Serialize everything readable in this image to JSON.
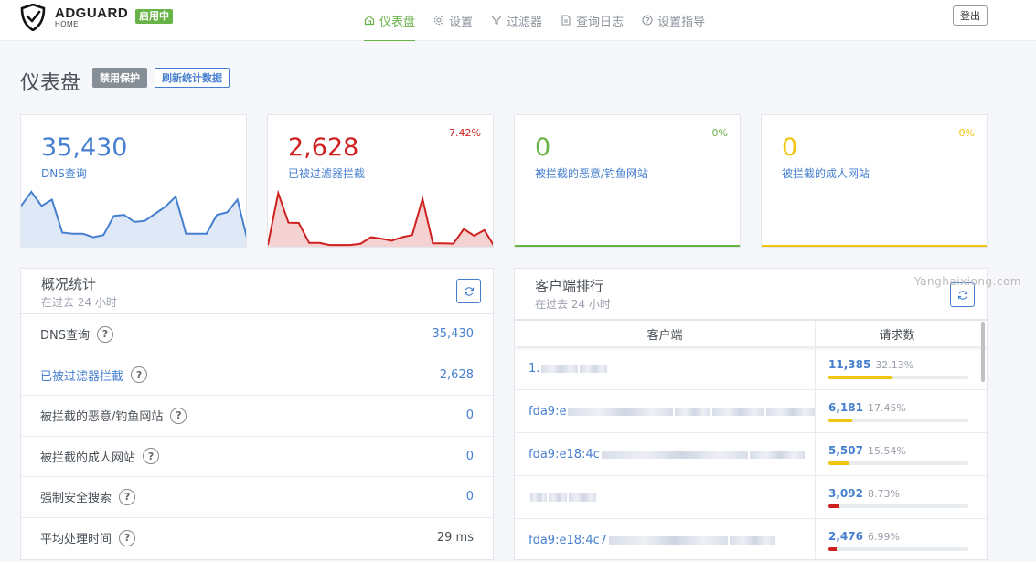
{
  "app": {
    "logo_text": "ADGUARD",
    "logo_sub": "HOME",
    "status_badge": "启用中",
    "accent_green": "#67b346",
    "accent_blue": "#467fcf",
    "accent_red": "#cd201f",
    "accent_yellow": "#f1c40f"
  },
  "nav": [
    {
      "label": "仪表盘",
      "icon": "home-icon",
      "active": true
    },
    {
      "label": "设置",
      "icon": "gear-icon",
      "active": false
    },
    {
      "label": "过滤器",
      "icon": "filter-icon",
      "active": false
    },
    {
      "label": "查询日志",
      "icon": "document-icon",
      "active": false
    },
    {
      "label": "设置指导",
      "icon": "question-circle-icon",
      "active": false
    }
  ],
  "logout_label": "登出",
  "page": {
    "title": "仪表盘",
    "disable_label": "禁用保护",
    "refresh_label": "刷新统计数据"
  },
  "cards": [
    {
      "value": "35,430",
      "label": "DNS查询",
      "pct": "",
      "color": "#467fcf",
      "chart_data": {
        "type": "area",
        "values": [
          12,
          16,
          12,
          13.8,
          4.5,
          4.2,
          4.2,
          3.2,
          3.8,
          9.2,
          9.5,
          7.5,
          7.8,
          9.8,
          11.8,
          14.6,
          4.2,
          4.2,
          4.2,
          9.5,
          10.2,
          13.8,
          2
        ]
      }
    },
    {
      "value": "2,628",
      "label": "已被过滤器拦截",
      "pct": "7.42%",
      "color": "#cd201f",
      "chart_data": {
        "type": "area",
        "values": [
          1,
          15.6,
          7.3,
          7.2,
          1.6,
          1.6,
          1,
          1,
          1,
          1.4,
          3.2,
          2.8,
          2.2,
          3.2,
          3.8,
          14,
          1.5,
          1.5,
          1.4,
          5.5,
          3.6,
          5.2,
          0.5
        ]
      }
    },
    {
      "value": "0",
      "label": "被拦截的恶意/钓鱼网站",
      "pct": "0%",
      "color": "#67b346"
    },
    {
      "value": "0",
      "label": "被拦截的成人网站",
      "pct": "0%",
      "color": "#f1c40f"
    }
  ],
  "general_stats": {
    "title": "概况统计",
    "subtitle": "在过去 24 小时",
    "rows": [
      {
        "label": "DNS查询",
        "value": "35,430",
        "label_blue": false,
        "value_dark": false
      },
      {
        "label": "已被过滤器拦截",
        "value": "2,628",
        "label_blue": true,
        "value_dark": false
      },
      {
        "label": "被拦截的恶意/钓鱼网站",
        "value": "0",
        "label_blue": false,
        "value_dark": false
      },
      {
        "label": "被拦截的成人网站",
        "value": "0",
        "label_blue": false,
        "value_dark": false
      },
      {
        "label": "强制安全搜索",
        "value": "0",
        "label_blue": false,
        "value_dark": false
      },
      {
        "label": "平均处理时间",
        "value": "29 ms",
        "label_blue": false,
        "value_dark": true
      }
    ]
  },
  "top_clients": {
    "title": "客户端排行",
    "subtitle": "在过去 24 小时",
    "col_client": "客户端",
    "col_requests": "请求数",
    "rows": [
      {
        "client": "1.",
        "count": "11,385",
        "pct": "32.13%",
        "fraction": 0.45,
        "bar_color": "#f1c40f"
      },
      {
        "client": "fda9:e",
        "count": "6,181",
        "pct": "17.45%",
        "fraction": 0.17,
        "bar_color": "#f1c40f"
      },
      {
        "client": "fda9:e18:4c",
        "count": "5,507",
        "pct": "15.54%",
        "fraction": 0.15,
        "bar_color": "#f1c40f"
      },
      {
        "client": "",
        "count": "3,092",
        "pct": "8.73%",
        "fraction": 0.08,
        "bar_color": "#cd201f"
      },
      {
        "client": "fda9:e18:4c7",
        "count": "2,476",
        "pct": "6.99%",
        "fraction": 0.06,
        "bar_color": "#cd201f"
      }
    ]
  },
  "watermark": "Yanghaixiong.com"
}
